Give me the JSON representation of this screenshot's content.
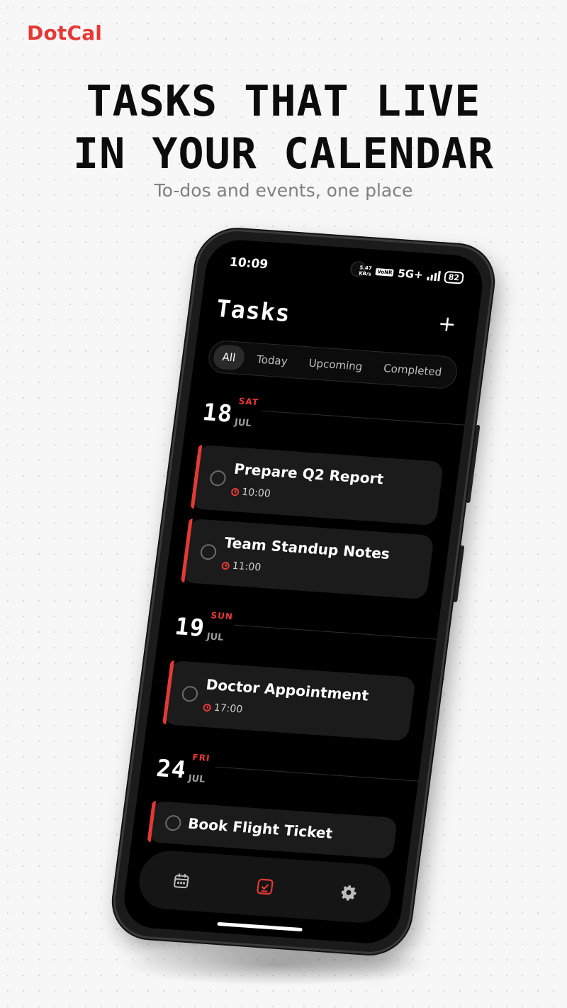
{
  "brand": "DotCal",
  "headline": {
    "line1": "TASKS THAT LIVE",
    "line2": "IN YOUR CALENDAR"
  },
  "subhead": "To-dos and events, one place",
  "status_bar": {
    "time": "10:09",
    "speed_value": "5.47",
    "speed_unit": "KB/s",
    "volte": "VoNR",
    "network": "5G+",
    "battery": "82"
  },
  "app": {
    "title": "Tasks",
    "add_label": "+",
    "tabs": [
      {
        "label": "All",
        "active": true
      },
      {
        "label": "Today"
      },
      {
        "label": "Upcoming"
      },
      {
        "label": "Completed"
      }
    ],
    "groups": [
      {
        "day": "18",
        "weekday": "SAT",
        "month": "JUL",
        "tasks": [
          {
            "name": "Prepare Q2 Report",
            "time": "10:00"
          },
          {
            "name": "Team Standup Notes",
            "time": "11:00"
          }
        ]
      },
      {
        "day": "19",
        "weekday": "SUN",
        "month": "JUL",
        "tasks": [
          {
            "name": "Doctor Appointment",
            "time": "17:00"
          }
        ]
      },
      {
        "day": "24",
        "weekday": "FRI",
        "month": "JUL",
        "tasks": [
          {
            "name": "Book Flight Ticket",
            "time": ""
          }
        ]
      }
    ]
  },
  "nav": {
    "items": [
      {
        "icon": "calendar-icon"
      },
      {
        "icon": "tasks-icon",
        "active": true
      },
      {
        "icon": "gear-icon"
      }
    ]
  },
  "colors": {
    "accent": "#e53935",
    "screen_bg": "#000000",
    "card_bg": "#1b1b1b"
  }
}
